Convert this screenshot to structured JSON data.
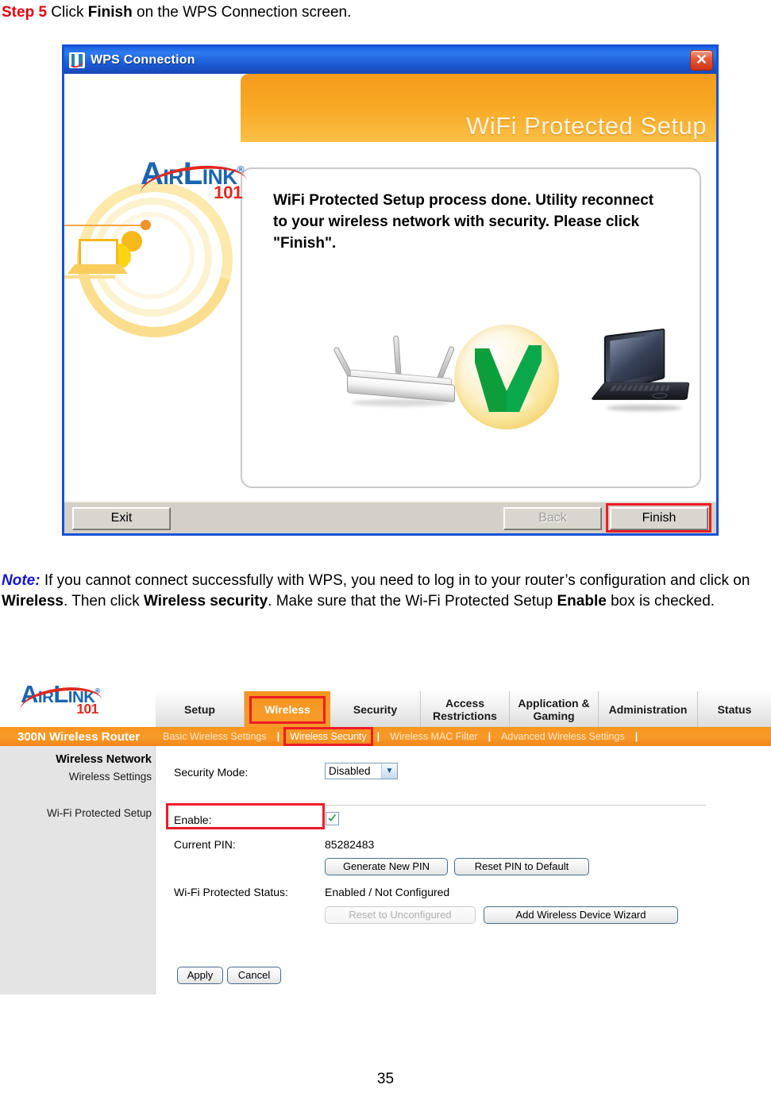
{
  "step": {
    "label": "Step 5",
    "text_before_bold": " Click ",
    "bold_word": "Finish",
    "text_after_bold": " on the WPS Connection screen."
  },
  "wps_dialog": {
    "title": "WPS Connection",
    "title_icon": "airlink-app-icon",
    "close_icon": "close-icon",
    "banner_title": "WiFi Protected Setup",
    "logo": {
      "cap_a": "A",
      "word1": "IR",
      "cap_l": "L",
      "word2": "INK",
      "registered": "®",
      "number": "101"
    },
    "message": "WiFi Protected Setup process done. Utility reconnect to your wireless network with security. Please click \"Finish\".",
    "graphics": {
      "ripple": "wireless-signal-laptop-art",
      "router": "router-image",
      "check": "green-check-badge",
      "laptop": "laptop-image"
    },
    "buttons": {
      "exit": "Exit",
      "back": "Back",
      "finish": "Finish"
    },
    "highlight_color": "#ee1c25",
    "titlebar_color": "#1b56cf",
    "banner_color": "#f7a823"
  },
  "note": {
    "label": "Note:",
    "part1": " If you cannot connect successfully with WPS,  you need to log in to your router’s configuration and click on ",
    "bold1": "Wireless",
    "part2": ".  Then click ",
    "bold2": "Wireless security",
    "part3": ".  Make sure that the Wi-Fi Protected Setup ",
    "bold3": "Enable",
    "part4": " box is checked."
  },
  "router_ui": {
    "logo": {
      "cap_a": "A",
      "word1": "IR",
      "cap_l": "L",
      "word2": "INK",
      "registered": "®",
      "number": "101"
    },
    "model": "300N Wireless Router",
    "tabs": [
      {
        "label": "Setup",
        "active": false,
        "highlighted": false
      },
      {
        "label": "Wireless",
        "active": true,
        "highlighted": true
      },
      {
        "label": "Security",
        "active": false,
        "highlighted": false
      },
      {
        "label": "Access Restrictions",
        "active": false,
        "highlighted": false
      },
      {
        "label": "Application & Gaming",
        "active": false,
        "highlighted": false
      },
      {
        "label": "Administration",
        "active": false,
        "highlighted": false
      },
      {
        "label": "Status",
        "active": false,
        "highlighted": false
      }
    ],
    "subtabs": [
      {
        "label": "Basic Wireless Settings",
        "active": false,
        "highlighted": false
      },
      {
        "label": "Wireless Security",
        "active": true,
        "highlighted": true
      },
      {
        "label": "Wireless MAC Filter",
        "active": false,
        "highlighted": false
      },
      {
        "label": "Advanced Wireless Settings",
        "active": false,
        "highlighted": false
      }
    ],
    "sidebar": {
      "title": "Wireless Network",
      "items": [
        {
          "label": "Wireless Settings"
        },
        {
          "label": "Wi-Fi Protected Setup"
        }
      ]
    },
    "form": {
      "security_mode_label": "Security Mode:",
      "security_mode_value": "Disabled",
      "enable_label": "Enable:",
      "enable_checked": true,
      "current_pin_label": "Current PIN:",
      "current_pin_value": "85282483",
      "generate_pin_button": "Generate New PIN",
      "reset_pin_button": "Reset PIN to Default",
      "status_label": "Wi-Fi Protected Status:",
      "status_value": "Enabled / Not Configured",
      "reset_unconfigured_button": "Reset to Unconfigured",
      "add_device_button": "Add Wireless Device Wizard",
      "apply_button": "Apply",
      "cancel_button": "Cancel"
    },
    "accent_color": "#f7941e",
    "highlight_color": "#ee1c25"
  },
  "page_number": "35"
}
